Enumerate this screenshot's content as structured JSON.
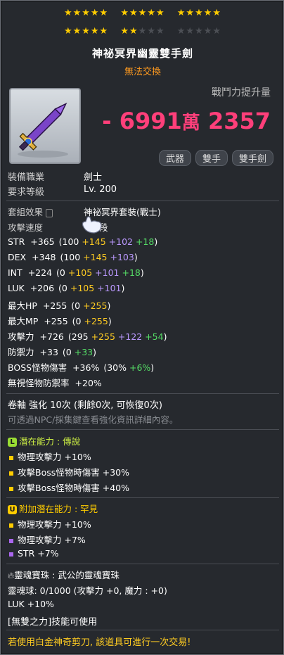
{
  "stars": {
    "row1": [
      "★★★★★",
      "★★★★★",
      "★★★★★"
    ],
    "row2_filled_a": "★★★★★",
    "row2_filled_b": "★★",
    "row2_empty_b": "★★★",
    "row2_empty_c": "★★★★★",
    "total": 25,
    "filled": 22
  },
  "item": {
    "name": "神祕冥界幽靈雙手劍",
    "trade": "無法交換",
    "combat_power_label": "戰鬥力提升量",
    "combat_power_value": "- 6991",
    "combat_power_unit1": "萬",
    "combat_power_value2": "2357",
    "tags": [
      "武器",
      "雙手",
      "雙手劍"
    ],
    "job_label": "裝備職業",
    "job_value": "劍士",
    "level_label": "要求等級",
    "level_value": "Lv. 200"
  },
  "set_effect": {
    "label": "套組效果",
    "value": "神祕冥界套裝(戰士)"
  },
  "attack_speed": {
    "label": "攻擊速度",
    "value": "段"
  },
  "stats": [
    {
      "name": "STR",
      "total": "+365",
      "parts": [
        {
          "t": "(100 ",
          "c": "w"
        },
        {
          "t": "+145",
          "c": "y"
        },
        {
          "t": " +102",
          "c": "p"
        },
        {
          "t": " +18",
          "c": "g"
        },
        {
          "t": ")",
          "c": "w"
        }
      ]
    },
    {
      "name": "DEX",
      "total": "+348",
      "parts": [
        {
          "t": "(100 ",
          "c": "w"
        },
        {
          "t": "+145",
          "c": "y"
        },
        {
          "t": " +103",
          "c": "p"
        },
        {
          "t": ")",
          "c": "w"
        }
      ]
    },
    {
      "name": "INT",
      "total": "+224",
      "parts": [
        {
          "t": "(0 ",
          "c": "w"
        },
        {
          "t": "+105",
          "c": "y"
        },
        {
          "t": " +101",
          "c": "p"
        },
        {
          "t": " +18",
          "c": "g"
        },
        {
          "t": ")",
          "c": "w"
        }
      ]
    },
    {
      "name": "LUK",
      "total": "+206",
      "parts": [
        {
          "t": "(0 ",
          "c": "w"
        },
        {
          "t": "+105",
          "c": "y"
        },
        {
          "t": " +101",
          "c": "p"
        },
        {
          "t": ")",
          "c": "w"
        }
      ]
    },
    {
      "name": "最大HP",
      "total": "+255",
      "parts": [
        {
          "t": "(0 ",
          "c": "w"
        },
        {
          "t": "+255",
          "c": "y"
        },
        {
          "t": ")",
          "c": "w"
        }
      ]
    },
    {
      "name": "最大MP",
      "total": "+255",
      "parts": [
        {
          "t": "(0 ",
          "c": "w"
        },
        {
          "t": "+255",
          "c": "y"
        },
        {
          "t": ")",
          "c": "w"
        }
      ]
    },
    {
      "name": "攻擊力",
      "total": "+726",
      "parts": [
        {
          "t": "(295 ",
          "c": "w"
        },
        {
          "t": "+255",
          "c": "y"
        },
        {
          "t": " +122",
          "c": "p"
        },
        {
          "t": " +54",
          "c": "g"
        },
        {
          "t": ")",
          "c": "w"
        }
      ]
    },
    {
      "name": "防禦力",
      "total": "+33",
      "parts": [
        {
          "t": "(0 ",
          "c": "w"
        },
        {
          "t": "+33",
          "c": "g"
        },
        {
          "t": ")",
          "c": "w"
        }
      ]
    },
    {
      "name": "BOSS怪物傷害",
      "total": "+36%",
      "parts": [
        {
          "t": "(30% ",
          "c": "w"
        },
        {
          "t": "+6%",
          "c": "g"
        },
        {
          "t": ")",
          "c": "w"
        }
      ]
    },
    {
      "name": "無視怪物防禦率",
      "total": "+20%",
      "parts": []
    }
  ],
  "scroll": {
    "line": "卷軸 強化 10次 (剩餘0次, 可恢復0次)",
    "hint": "可透過NPC/採集鍵查看強化資訊詳細內容。"
  },
  "potential": {
    "icon": "L",
    "label": "潛在能力 : 傳說",
    "lines": [
      "物理攻擊力 +10%",
      "攻擊Boss怪物時傷害 +30%",
      "攻擊Boss怪物時傷害 +40%"
    ],
    "color": "#ccee44"
  },
  "bonus_potential": {
    "icon": "U",
    "label": "附加潛在能力 : 罕見",
    "lines": [
      "物理攻擊力 +10%",
      "物理攻擊力 +7%",
      "STR +7%"
    ],
    "color": "#ffcc00"
  },
  "soul": {
    "name_line": "靈魂寶珠 : 武公的靈魂寶珠",
    "orb_line": "靈魂球:  0/1000 (攻擊力 +0, 魔力 : +0)",
    "luk_line": "LUK +10%"
  },
  "skill_line": "[無雙之力]技能可使用",
  "footer": "若使用白金神奇剪刀, 該道具可進行一次交易!"
}
